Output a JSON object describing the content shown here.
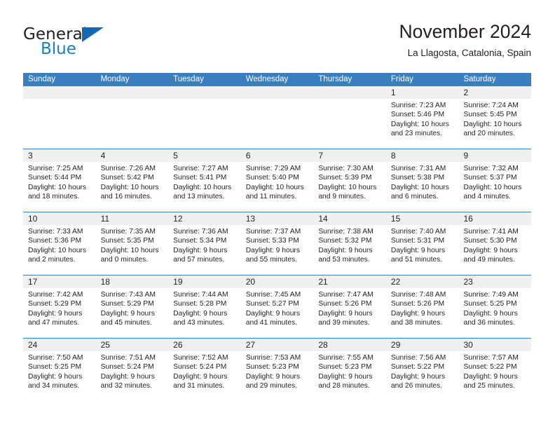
{
  "brand": {
    "word_one": "General",
    "word_two": "Blue",
    "mark": "triangle-logo-icon"
  },
  "header": {
    "title": "November 2024",
    "location": "La Llagosta, Catalonia, Spain"
  },
  "colors": {
    "header_blue": "#3b7ec0",
    "brand_blue": "#1b7fc4",
    "day_band_gray": "#f0f0f0",
    "text": "#231f20"
  },
  "weekdays": [
    "Sunday",
    "Monday",
    "Tuesday",
    "Wednesday",
    "Thursday",
    "Friday",
    "Saturday"
  ],
  "weeks": [
    [
      {
        "day": "",
        "lines": []
      },
      {
        "day": "",
        "lines": []
      },
      {
        "day": "",
        "lines": []
      },
      {
        "day": "",
        "lines": []
      },
      {
        "day": "",
        "lines": []
      },
      {
        "day": "1",
        "lines": [
          "Sunrise: 7:23 AM",
          "Sunset: 5:46 PM",
          "Daylight: 10 hours",
          "and 23 minutes."
        ]
      },
      {
        "day": "2",
        "lines": [
          "Sunrise: 7:24 AM",
          "Sunset: 5:45 PM",
          "Daylight: 10 hours",
          "and 20 minutes."
        ]
      }
    ],
    [
      {
        "day": "3",
        "lines": [
          "Sunrise: 7:25 AM",
          "Sunset: 5:44 PM",
          "Daylight: 10 hours",
          "and 18 minutes."
        ]
      },
      {
        "day": "4",
        "lines": [
          "Sunrise: 7:26 AM",
          "Sunset: 5:42 PM",
          "Daylight: 10 hours",
          "and 16 minutes."
        ]
      },
      {
        "day": "5",
        "lines": [
          "Sunrise: 7:27 AM",
          "Sunset: 5:41 PM",
          "Daylight: 10 hours",
          "and 13 minutes."
        ]
      },
      {
        "day": "6",
        "lines": [
          "Sunrise: 7:29 AM",
          "Sunset: 5:40 PM",
          "Daylight: 10 hours",
          "and 11 minutes."
        ]
      },
      {
        "day": "7",
        "lines": [
          "Sunrise: 7:30 AM",
          "Sunset: 5:39 PM",
          "Daylight: 10 hours",
          "and 9 minutes."
        ]
      },
      {
        "day": "8",
        "lines": [
          "Sunrise: 7:31 AM",
          "Sunset: 5:38 PM",
          "Daylight: 10 hours",
          "and 6 minutes."
        ]
      },
      {
        "day": "9",
        "lines": [
          "Sunrise: 7:32 AM",
          "Sunset: 5:37 PM",
          "Daylight: 10 hours",
          "and 4 minutes."
        ]
      }
    ],
    [
      {
        "day": "10",
        "lines": [
          "Sunrise: 7:33 AM",
          "Sunset: 5:36 PM",
          "Daylight: 10 hours",
          "and 2 minutes."
        ]
      },
      {
        "day": "11",
        "lines": [
          "Sunrise: 7:35 AM",
          "Sunset: 5:35 PM",
          "Daylight: 10 hours",
          "and 0 minutes."
        ]
      },
      {
        "day": "12",
        "lines": [
          "Sunrise: 7:36 AM",
          "Sunset: 5:34 PM",
          "Daylight: 9 hours",
          "and 57 minutes."
        ]
      },
      {
        "day": "13",
        "lines": [
          "Sunrise: 7:37 AM",
          "Sunset: 5:33 PM",
          "Daylight: 9 hours",
          "and 55 minutes."
        ]
      },
      {
        "day": "14",
        "lines": [
          "Sunrise: 7:38 AM",
          "Sunset: 5:32 PM",
          "Daylight: 9 hours",
          "and 53 minutes."
        ]
      },
      {
        "day": "15",
        "lines": [
          "Sunrise: 7:40 AM",
          "Sunset: 5:31 PM",
          "Daylight: 9 hours",
          "and 51 minutes."
        ]
      },
      {
        "day": "16",
        "lines": [
          "Sunrise: 7:41 AM",
          "Sunset: 5:30 PM",
          "Daylight: 9 hours",
          "and 49 minutes."
        ]
      }
    ],
    [
      {
        "day": "17",
        "lines": [
          "Sunrise: 7:42 AM",
          "Sunset: 5:29 PM",
          "Daylight: 9 hours",
          "and 47 minutes."
        ]
      },
      {
        "day": "18",
        "lines": [
          "Sunrise: 7:43 AM",
          "Sunset: 5:29 PM",
          "Daylight: 9 hours",
          "and 45 minutes."
        ]
      },
      {
        "day": "19",
        "lines": [
          "Sunrise: 7:44 AM",
          "Sunset: 5:28 PM",
          "Daylight: 9 hours",
          "and 43 minutes."
        ]
      },
      {
        "day": "20",
        "lines": [
          "Sunrise: 7:45 AM",
          "Sunset: 5:27 PM",
          "Daylight: 9 hours",
          "and 41 minutes."
        ]
      },
      {
        "day": "21",
        "lines": [
          "Sunrise: 7:47 AM",
          "Sunset: 5:26 PM",
          "Daylight: 9 hours",
          "and 39 minutes."
        ]
      },
      {
        "day": "22",
        "lines": [
          "Sunrise: 7:48 AM",
          "Sunset: 5:26 PM",
          "Daylight: 9 hours",
          "and 38 minutes."
        ]
      },
      {
        "day": "23",
        "lines": [
          "Sunrise: 7:49 AM",
          "Sunset: 5:25 PM",
          "Daylight: 9 hours",
          "and 36 minutes."
        ]
      }
    ],
    [
      {
        "day": "24",
        "lines": [
          "Sunrise: 7:50 AM",
          "Sunset: 5:25 PM",
          "Daylight: 9 hours",
          "and 34 minutes."
        ]
      },
      {
        "day": "25",
        "lines": [
          "Sunrise: 7:51 AM",
          "Sunset: 5:24 PM",
          "Daylight: 9 hours",
          "and 32 minutes."
        ]
      },
      {
        "day": "26",
        "lines": [
          "Sunrise: 7:52 AM",
          "Sunset: 5:24 PM",
          "Daylight: 9 hours",
          "and 31 minutes."
        ]
      },
      {
        "day": "27",
        "lines": [
          "Sunrise: 7:53 AM",
          "Sunset: 5:23 PM",
          "Daylight: 9 hours",
          "and 29 minutes."
        ]
      },
      {
        "day": "28",
        "lines": [
          "Sunrise: 7:55 AM",
          "Sunset: 5:23 PM",
          "Daylight: 9 hours",
          "and 28 minutes."
        ]
      },
      {
        "day": "29",
        "lines": [
          "Sunrise: 7:56 AM",
          "Sunset: 5:22 PM",
          "Daylight: 9 hours",
          "and 26 minutes."
        ]
      },
      {
        "day": "30",
        "lines": [
          "Sunrise: 7:57 AM",
          "Sunset: 5:22 PM",
          "Daylight: 9 hours",
          "and 25 minutes."
        ]
      }
    ]
  ]
}
